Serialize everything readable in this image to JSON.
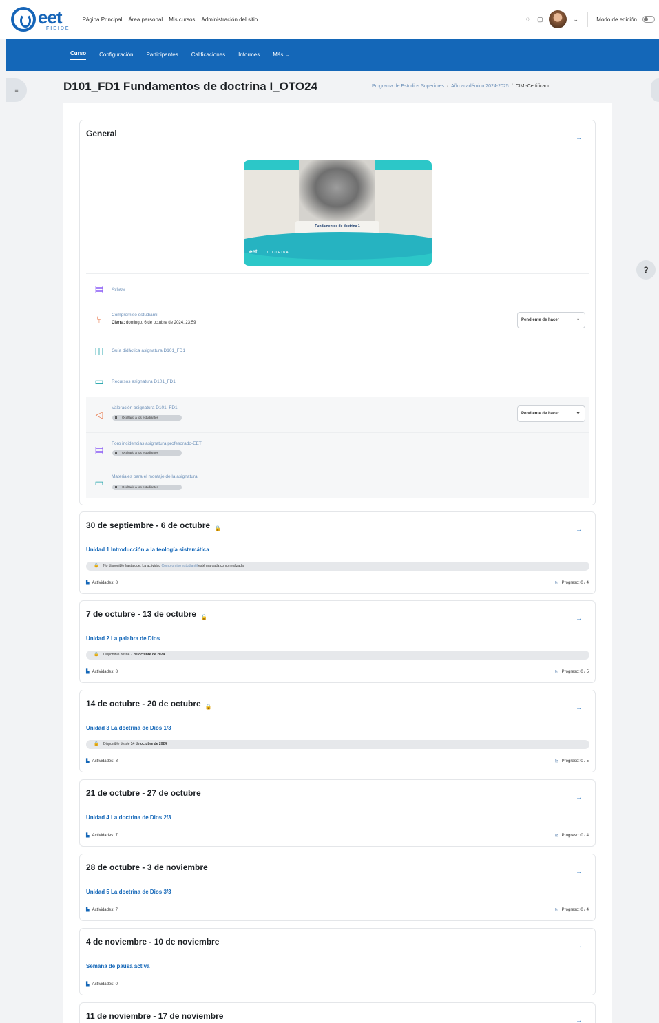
{
  "header": {
    "logo_text": "eet",
    "logo_sub": "FIEIDE",
    "nav": [
      "Página Principal",
      "Área personal",
      "Mis cursos",
      "Administración del sitio"
    ],
    "edit_mode_label": "Modo de edición"
  },
  "course_nav": {
    "tabs": [
      "Curso",
      "Configuración",
      "Participantes",
      "Calificaciones",
      "Informes",
      "Más"
    ]
  },
  "page": {
    "title": "D101_FD1 Fundamentos de doctrina I_OTO24",
    "breadcrumb": [
      "Programa de Estudios Superiores",
      "Año académico 2024-2025",
      "CIMI-Certificado"
    ]
  },
  "general": {
    "title": "General",
    "banner_caption": "Fundamentos de doctrina 1",
    "banner_logo": "eet",
    "banner_tag": "DOCTRINA",
    "activities": [
      {
        "name": "Avisos",
        "icon": "forum-icon"
      },
      {
        "name": "Compromiso estudiantil",
        "icon": "choice-icon",
        "detail_label": "Cierra:",
        "detail": "domingo, 6 de octubre de 2024, 23:59",
        "status": "Pendiente de hacer"
      },
      {
        "name": "Guía didáctica asignatura D101_FD1",
        "icon": "book-icon"
      },
      {
        "name": "Recursos asignatura D101_FD1",
        "icon": "folder-icon"
      },
      {
        "name": "Valoración asignatura D101_FD1",
        "icon": "feedback-icon",
        "badge": "Ocultado a los estudiantes",
        "status": "Pendiente de hacer"
      },
      {
        "name": "Foro incidencias asignatura profesorado-EET",
        "icon": "forum-icon",
        "badge": "Ocultado a los estudiantes"
      },
      {
        "name": "Materiales para el montaje de la asignatura",
        "icon": "folder-icon",
        "badge": "Ocultado a los estudiantes"
      }
    ]
  },
  "sections": [
    {
      "title": "30 de septiembre - 6 de octubre",
      "locked": true,
      "unit": "Unidad 1 Introducción a la teología sistemática",
      "restriction_pre": "No disponible hasta que: La actividad",
      "restriction_link": "Compromiso estudiantil",
      "restriction_post": "esté marcada como realizada",
      "activities": "Actividades: 8",
      "progress": "Progreso: 0 / 4"
    },
    {
      "title": "7 de octubre - 13 de octubre",
      "locked": true,
      "unit": "Unidad 2 La palabra de Dios",
      "restriction_pre": "Disponible desde",
      "restriction_bold": "7 de octubre de 2024",
      "activities": "Actividades: 8",
      "progress": "Progreso: 0 / 5"
    },
    {
      "title": "14 de octubre - 20 de octubre",
      "locked": true,
      "unit": "Unidad 3 La doctrina de Dios 1/3",
      "restriction_pre": "Disponible desde",
      "restriction_bold": "14 de octubre de 2024",
      "activities": "Actividades: 8",
      "progress": "Progreso: 0 / 5"
    },
    {
      "title": "21 de octubre - 27 de octubre",
      "locked": false,
      "unit": "Unidad 4 La doctrina de Dios 2/3",
      "activities": "Actividades: 7",
      "progress": "Progreso: 0 / 4"
    },
    {
      "title": "28 de octubre - 3 de noviembre",
      "locked": false,
      "unit": "Unidad 5 La doctrina de Dios 3/3",
      "activities": "Actividades: 7",
      "progress": "Progreso: 0 / 4"
    },
    {
      "title": "4 de noviembre - 10 de noviembre",
      "locked": false,
      "unit": "Semana de pausa activa",
      "activities": "Actividades: 0"
    },
    {
      "title": "11 de noviembre - 17 de noviembre",
      "locked": false
    }
  ],
  "colors": {
    "brand": "#1467b8",
    "link": "#1467b8",
    "muted_link": "#6b8fb8"
  }
}
